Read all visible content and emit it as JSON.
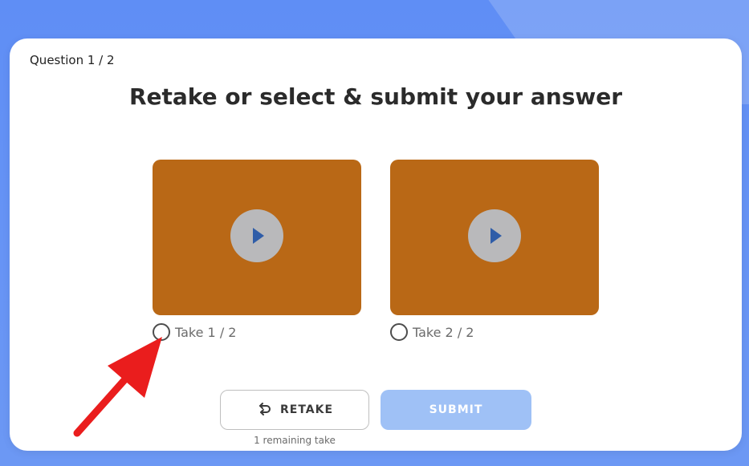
{
  "header": {
    "question_counter": "Question 1 / 2"
  },
  "main": {
    "title": "Retake or select & submit your answer",
    "takes": [
      {
        "label": "Take 1 / 2",
        "selected": false,
        "icon": "play-icon"
      },
      {
        "label": "Take 2 / 2",
        "selected": false,
        "icon": "play-icon"
      }
    ],
    "actions": {
      "retake_label": "RETAKE",
      "retake_icon": "retake-icon",
      "submit_label": "SUBMIT",
      "remaining_takes": "1 remaining take"
    }
  },
  "colors": {
    "background": "#6794f5",
    "video_tile": "#b96816",
    "play_button": "#b9b9bb",
    "play_icon": "#2f5da8",
    "submit_disabled": "#9fc1f6",
    "annotation_arrow": "#ea1d1d"
  }
}
